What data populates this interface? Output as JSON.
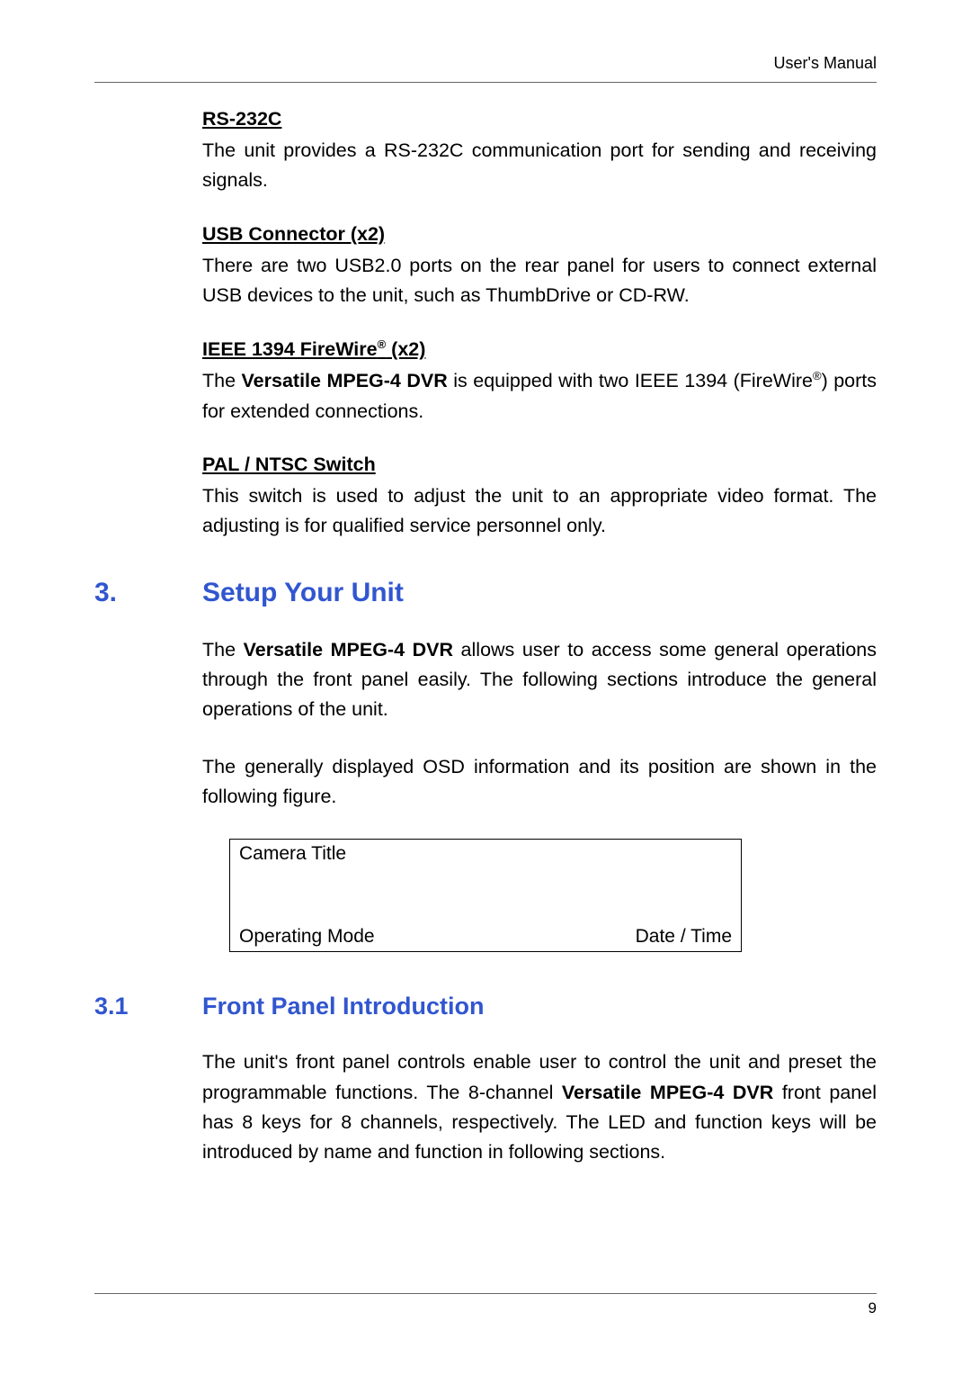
{
  "header": {
    "manual": "User's Manual"
  },
  "sections": [
    {
      "heading": "RS-232C",
      "body": "The unit provides a RS-232C communication port for sending and receiving signals."
    },
    {
      "heading": "USB Connector (x2)",
      "body": "There are two USB2.0 ports on the rear panel for users to connect external USB devices to the unit, such as ThumbDrive or CD-RW."
    },
    {
      "heading_pre": "IEEE 1394 FireWire",
      "heading_sup": "®",
      "heading_post": " (x2)",
      "body_pre": "The ",
      "body_bold": "Versatile MPEG-4 DVR",
      "body_mid": " is equipped with two IEEE 1394 (FireWire",
      "body_sup": "®",
      "body_post": ") ports for extended connections."
    },
    {
      "heading": "PAL / NTSC Switch",
      "body": "This switch is used to adjust the unit to an appropriate video format. The adjusting is for qualified service personnel only."
    }
  ],
  "chapter3": {
    "num": "3.",
    "title": "Setup Your Unit",
    "para1_pre": "The ",
    "para1_bold": "Versatile MPEG-4 DVR",
    "para1_post": " allows user to access some general operations through the front panel easily. The following sections introduce the general operations of the unit.",
    "para2": "The generally displayed OSD information and its position are shown in the following figure."
  },
  "osd": {
    "camera": "Camera Title",
    "mode": "Operating Mode",
    "datetime": "Date  /  Time"
  },
  "section31": {
    "num": "3.1",
    "title": "Front Panel Introduction",
    "para_pre": "The unit's front panel controls enable user to control the unit and preset the programmable functions. The 8-channel ",
    "para_bold": "Versatile MPEG-4 DVR",
    "para_post": " front panel has 8 keys for 8 channels, respectively. The LED and function keys will be introduced by name and function in following sections."
  },
  "footer": {
    "page": "9"
  }
}
